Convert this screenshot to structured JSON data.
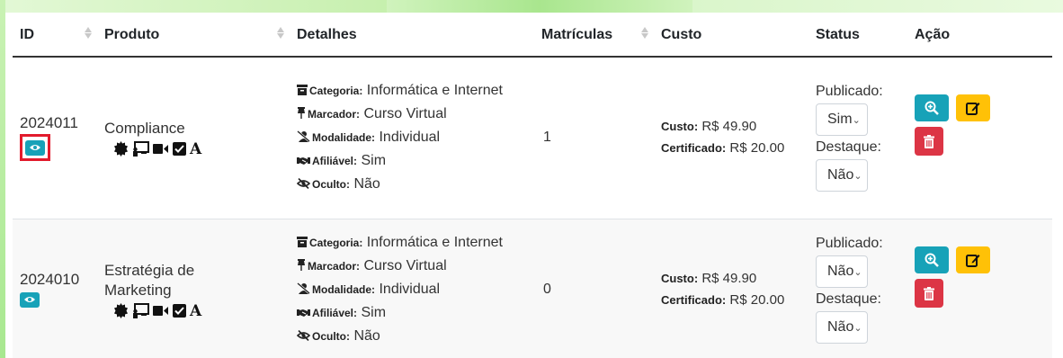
{
  "columns": {
    "id": "ID",
    "produto": "Produto",
    "detalhes": "Detalhes",
    "matriculas": "Matrículas",
    "custo": "Custo",
    "status": "Status",
    "acao": "Ação"
  },
  "labels": {
    "categoria": "Categoria:",
    "marcador": "Marcador:",
    "modalidade": "Modalidade:",
    "afiliavel": "Afiliável:",
    "oculto": "Oculto:",
    "custo": "Custo:",
    "certificado": "Certificado:",
    "publicado": "Publicado:",
    "destaque": "Destaque:"
  },
  "rows": [
    {
      "id": "2024011",
      "produto_line1": "Compliance",
      "produto_line2": "",
      "categoria": "Informática e Internet",
      "marcador": "Curso Virtual",
      "modalidade": "Individual",
      "afiliavel": "Sim",
      "oculto": "Não",
      "matriculas": "1",
      "custo": "R$ 49.90",
      "certificado": "R$ 20.00",
      "publicado": "Sim",
      "destaque": "Não",
      "highlighted": true
    },
    {
      "id": "2024010",
      "produto_line1": "Estratégia de",
      "produto_line2": "Marketing",
      "categoria": "Informática e Internet",
      "marcador": "Curso Virtual",
      "modalidade": "Individual",
      "afiliavel": "Sim",
      "oculto": "Não",
      "matriculas": "0",
      "custo": "R$ 49.90",
      "certificado": "R$ 20.00",
      "publicado": "Não",
      "destaque": "Não",
      "highlighted": false
    }
  ],
  "colors": {
    "info": "#17a2b8",
    "warning": "#ffc107",
    "danger": "#dc3545",
    "highlight": "#e21b2c",
    "frame": "#b8ec9c"
  },
  "icons": {
    "view": "eye-icon",
    "details": "zoom-in-icon",
    "edit": "edit-icon",
    "delete": "trash-icon",
    "produto": [
      "certificate-icon",
      "chalkboard-icon",
      "video-icon",
      "checkbox-icon",
      "font-icon"
    ],
    "detalhes": [
      "archive-icon",
      "thumbtack-icon",
      "user-slash-icon",
      "handshake-icon",
      "eye-slash-icon"
    ]
  }
}
